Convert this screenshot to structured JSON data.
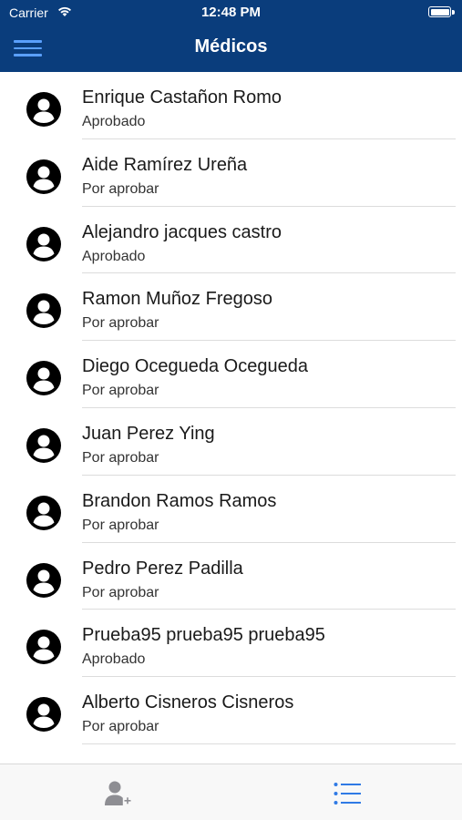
{
  "status_bar": {
    "carrier": "Carrier",
    "time": "12:48 PM"
  },
  "header": {
    "title": "Médicos",
    "background_color": "#0a3d7c",
    "menu_icon": "hamburger-menu-icon"
  },
  "list": {
    "items": [
      {
        "name": "Enrique Castañon Romo",
        "status": "Aprobado"
      },
      {
        "name": "Aide Ramírez Ureña",
        "status": "Por aprobar"
      },
      {
        "name": "Alejandro jacques castro",
        "status": "Aprobado"
      },
      {
        "name": "Ramon Muñoz Fregoso",
        "status": "Por aprobar"
      },
      {
        "name": "Diego Ocegueda Ocegueda",
        "status": "Por aprobar"
      },
      {
        "name": "Juan Perez Ying",
        "status": "Por aprobar"
      },
      {
        "name": "Brandon Ramos Ramos",
        "status": "Por aprobar"
      },
      {
        "name": "Pedro Perez Padilla",
        "status": "Por aprobar"
      },
      {
        "name": "Prueba95 prueba95 prueba95",
        "status": "Aprobado"
      },
      {
        "name": "Alberto Cisneros Cisneros",
        "status": "Por aprobar"
      }
    ],
    "avatar_icon": "user-avatar-icon"
  },
  "tab_bar": {
    "tabs": [
      {
        "icon": "add-user-icon",
        "active": false
      },
      {
        "icon": "list-icon",
        "active": true
      }
    ],
    "active_color": "#2f7ae5",
    "inactive_color": "#8e8e93"
  }
}
